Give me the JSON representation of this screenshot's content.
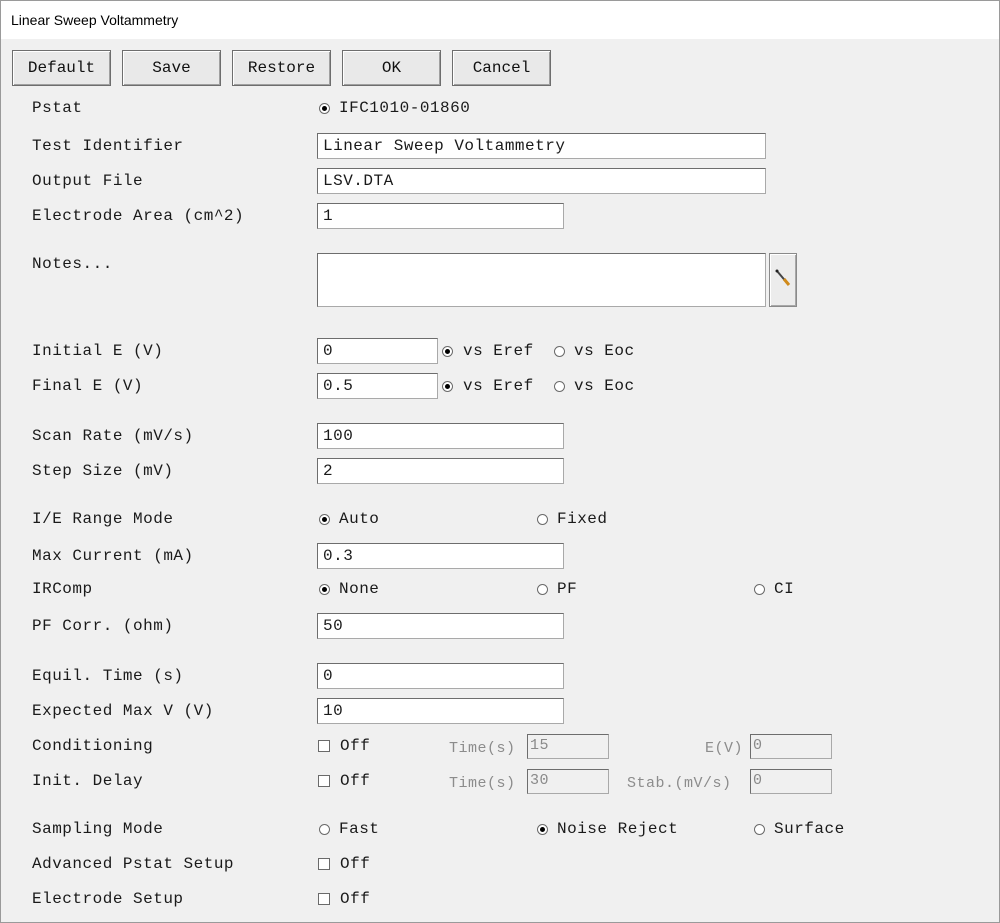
{
  "window": {
    "title": "Linear Sweep Voltammetry"
  },
  "toolbar": {
    "default_label": "Default",
    "save_label": "Save",
    "restore_label": "Restore",
    "ok_label": "OK",
    "cancel_label": "Cancel"
  },
  "pstat": {
    "label": "Pstat",
    "value": "IFC1010-01860"
  },
  "test_identifier": {
    "label": "Test Identifier",
    "value": "Linear Sweep Voltammetry"
  },
  "output_file": {
    "label": "Output File",
    "value": "LSV.DTA"
  },
  "electrode_area": {
    "label": "Electrode Area (cm^2)",
    "value": "1"
  },
  "notes": {
    "label": "Notes...",
    "value": "",
    "edit_icon": "pencil-icon"
  },
  "initial_e": {
    "label": "Initial E (V)",
    "value": "0",
    "opt1": "vs Eref",
    "opt2": "vs Eoc",
    "selected": "vs Eref"
  },
  "final_e": {
    "label": "Final E (V)",
    "value": "0.5",
    "opt1": "vs Eref",
    "opt2": "vs Eoc",
    "selected": "vs Eref"
  },
  "scan_rate": {
    "label": "Scan Rate (mV/s)",
    "value": "100"
  },
  "step_size": {
    "label": "Step Size (mV)",
    "value": "2"
  },
  "ie_range_mode": {
    "label": "I/E Range Mode",
    "opt1": "Auto",
    "opt2": "Fixed",
    "selected": "Auto"
  },
  "max_current": {
    "label": "Max Current (mA)",
    "value": "0.3"
  },
  "ircomp": {
    "label": "IRComp",
    "opt1": "None",
    "opt2": "PF",
    "opt3": "CI",
    "selected": "None"
  },
  "pf_corr": {
    "label": "PF Corr. (ohm)",
    "value": "50"
  },
  "equil_time": {
    "label": "Equil. Time (s)",
    "value": "0"
  },
  "expected_max_v": {
    "label": "Expected Max V (V)",
    "value": "10"
  },
  "conditioning": {
    "label": "Conditioning",
    "check_label": "Off",
    "time_label": "Time(s)",
    "time_value": "15",
    "e_label": "E(V)",
    "e_value": "0"
  },
  "init_delay": {
    "label": "Init. Delay",
    "check_label": "Off",
    "time_label": "Time(s)",
    "time_value": "30",
    "stab_label": "Stab.(mV/s)",
    "stab_value": "0"
  },
  "sampling_mode": {
    "label": "Sampling Mode",
    "opt1": "Fast",
    "opt2": "Noise Reject",
    "opt3": "Surface",
    "selected": "Noise Reject"
  },
  "advanced_pstat_setup": {
    "label": "Advanced Pstat Setup",
    "check_label": "Off"
  },
  "electrode_setup": {
    "label": "Electrode Setup",
    "check_label": "Off"
  },
  "colors": {
    "background": "#f0f0f0",
    "field": "#ffffff",
    "border": "#6d6d6d"
  }
}
